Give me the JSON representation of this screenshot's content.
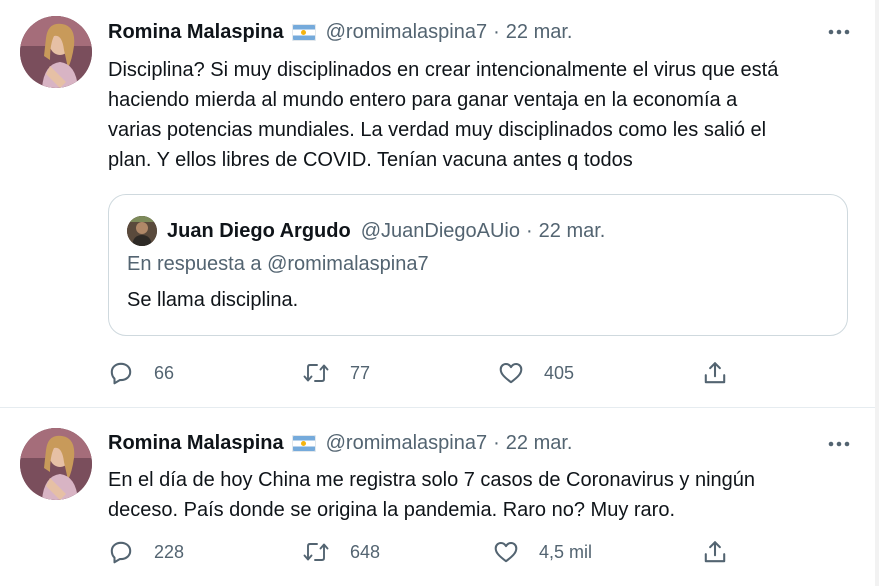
{
  "tweets": [
    {
      "author_name": "Romina Malaspina",
      "author_handle": "@romimalaspina7",
      "separator": "·",
      "date": "22 mar.",
      "text": "Disciplina? Si muy disciplinados en crear intencionalmente el virus que está\nhaciendo mierda al mundo entero  para ganar ventaja en la economía a\nvarias potencias mundiales. La verdad muy disciplinados como les salió el\nplan. Y ellos libres de COVID. Tenían vacuna antes q todos",
      "quoted": {
        "author_name": "Juan Diego Argudo",
        "author_handle": "@JuanDiegoAUio",
        "separator": "·",
        "date": "22 mar.",
        "reply_prefix": "En respuesta a",
        "reply_to": "@romimalaspina7",
        "text": "Se llama disciplina."
      },
      "reply_count": "66",
      "retweet_count": "77",
      "like_count": "405"
    },
    {
      "author_name": "Romina Malaspina",
      "author_handle": "@romimalaspina7",
      "separator": "·",
      "date": "22 mar.",
      "text": "En el día de hoy China me registra solo 7 casos de Coronavirus y ningún\ndeceso. País donde se origina la pandemia. Raro no? Muy raro.",
      "reply_count": "228",
      "retweet_count": "648",
      "like_count": "4,5 mil"
    }
  ],
  "icons": {
    "flag": "argentina-flag-icon",
    "more": "more-icon",
    "reply": "reply-icon",
    "retweet": "retweet-icon",
    "like": "like-icon",
    "share": "share-icon"
  },
  "colors": {
    "text": "#0f1419",
    "secondary": "#536471",
    "divider": "#e6ecf0",
    "quote_border": "#cfd9de"
  }
}
